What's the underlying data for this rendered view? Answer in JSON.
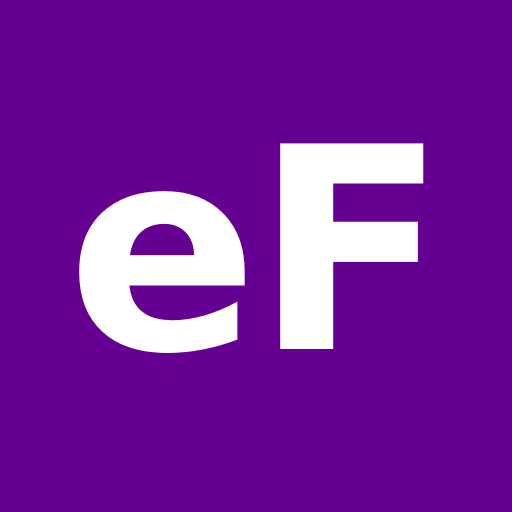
{
  "logo": {
    "text": "eF"
  },
  "colors": {
    "background": "#650092",
    "text": "#ffffff"
  }
}
